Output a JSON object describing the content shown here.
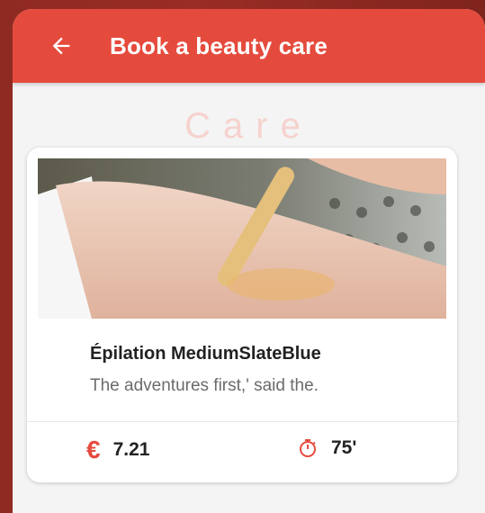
{
  "appbar": {
    "title": "Book a beauty care",
    "back_icon": "arrow-left-icon"
  },
  "section": {
    "heading": "Care"
  },
  "card": {
    "image_alt": "waxing-photo",
    "title": "Épilation MediumSlateBlue",
    "description": "The adventures first,' said the.",
    "price": {
      "icon": "euro-icon",
      "value": "7.21"
    },
    "duration": {
      "icon": "timer-icon",
      "value": "75'"
    }
  },
  "colors": {
    "primary": "#e54b3d",
    "section_text": "#f6d2ce"
  }
}
